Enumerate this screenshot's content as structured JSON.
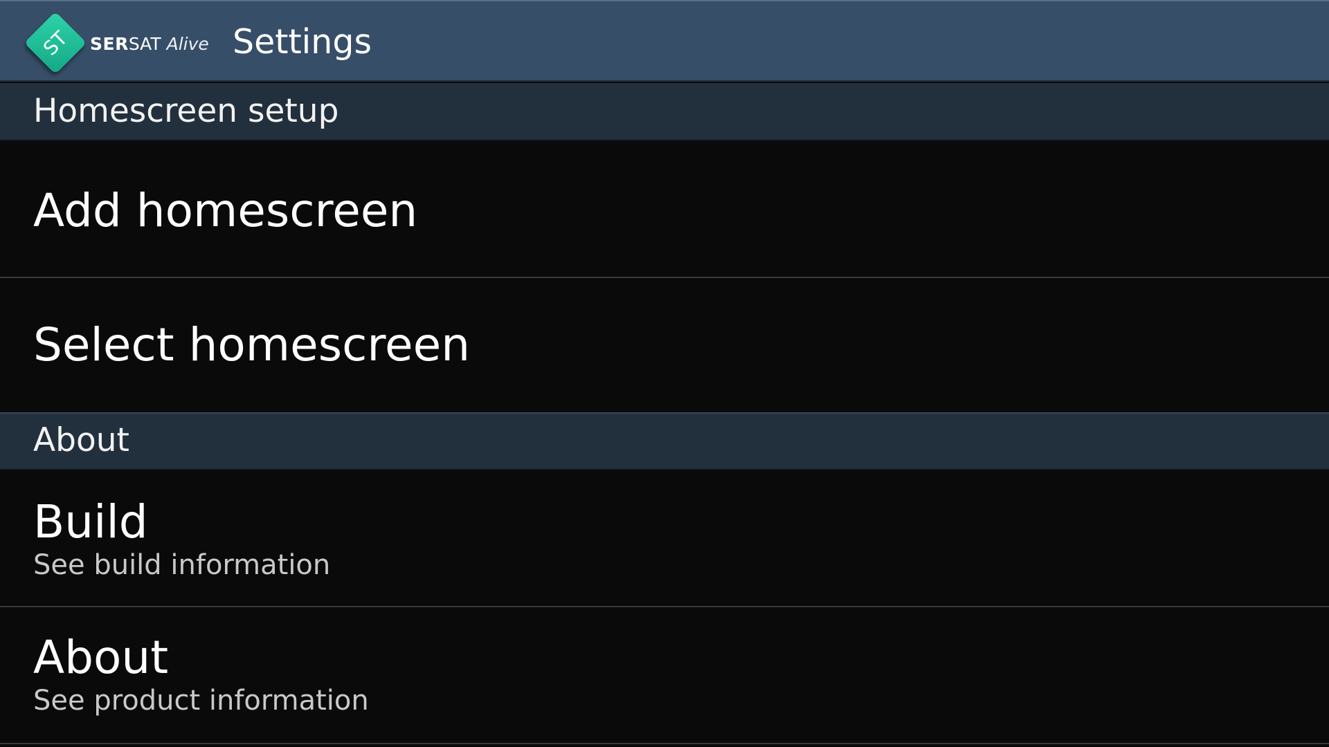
{
  "action_bar": {
    "logo": {
      "mark": "ST",
      "brand_bold": "SER",
      "brand_light": "SAT",
      "brand_tagline": "Alive"
    },
    "title": "Settings"
  },
  "sections": [
    {
      "header": "Homescreen setup",
      "items": [
        {
          "title": "Add homescreen"
        },
        {
          "title": "Select homescreen"
        }
      ]
    },
    {
      "header": "About",
      "items": [
        {
          "title": "Build",
          "summary": "See build information"
        },
        {
          "title": "About",
          "summary": "See product information"
        }
      ]
    }
  ],
  "colors": {
    "action_bar": "#374e68",
    "section_header": "#22303d",
    "background": "#0a0a0a",
    "logo_accent": "#1fbf97"
  }
}
